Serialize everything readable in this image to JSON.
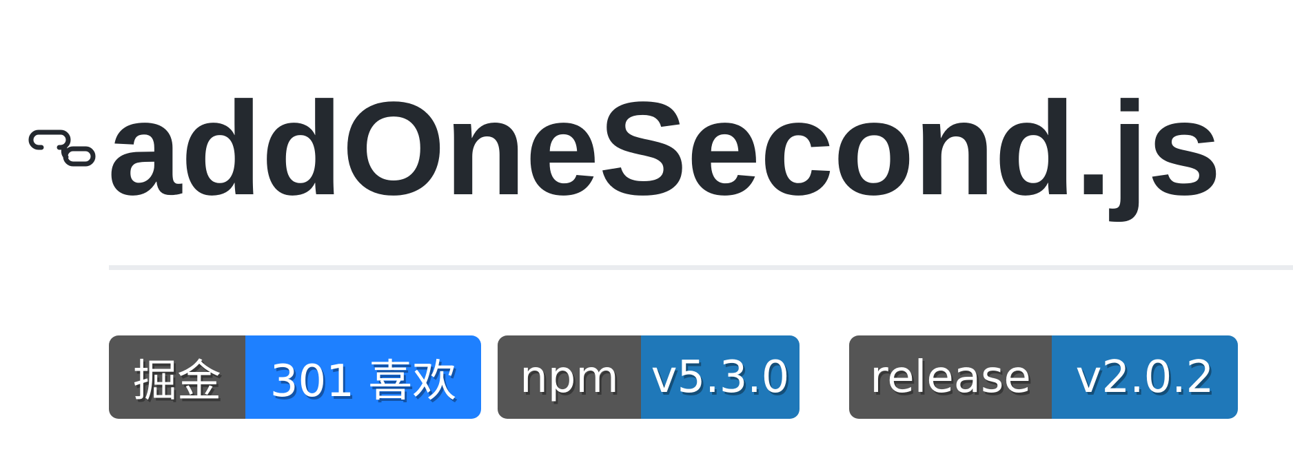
{
  "heading": {
    "title": "addOneSecond.js",
    "anchor_icon": "link-icon"
  },
  "badges": [
    {
      "label": "掘金",
      "message": "301 喜欢",
      "color": "#1e80ff"
    },
    {
      "label": "npm",
      "message": "v5.3.0",
      "color": "#1f78b9"
    },
    {
      "label": "release",
      "message": "v2.0.2",
      "color": "#1f78b9"
    }
  ],
  "colors": {
    "text": "#24292f",
    "badge_label_bg": "#555555",
    "rule": "#eaecef"
  }
}
